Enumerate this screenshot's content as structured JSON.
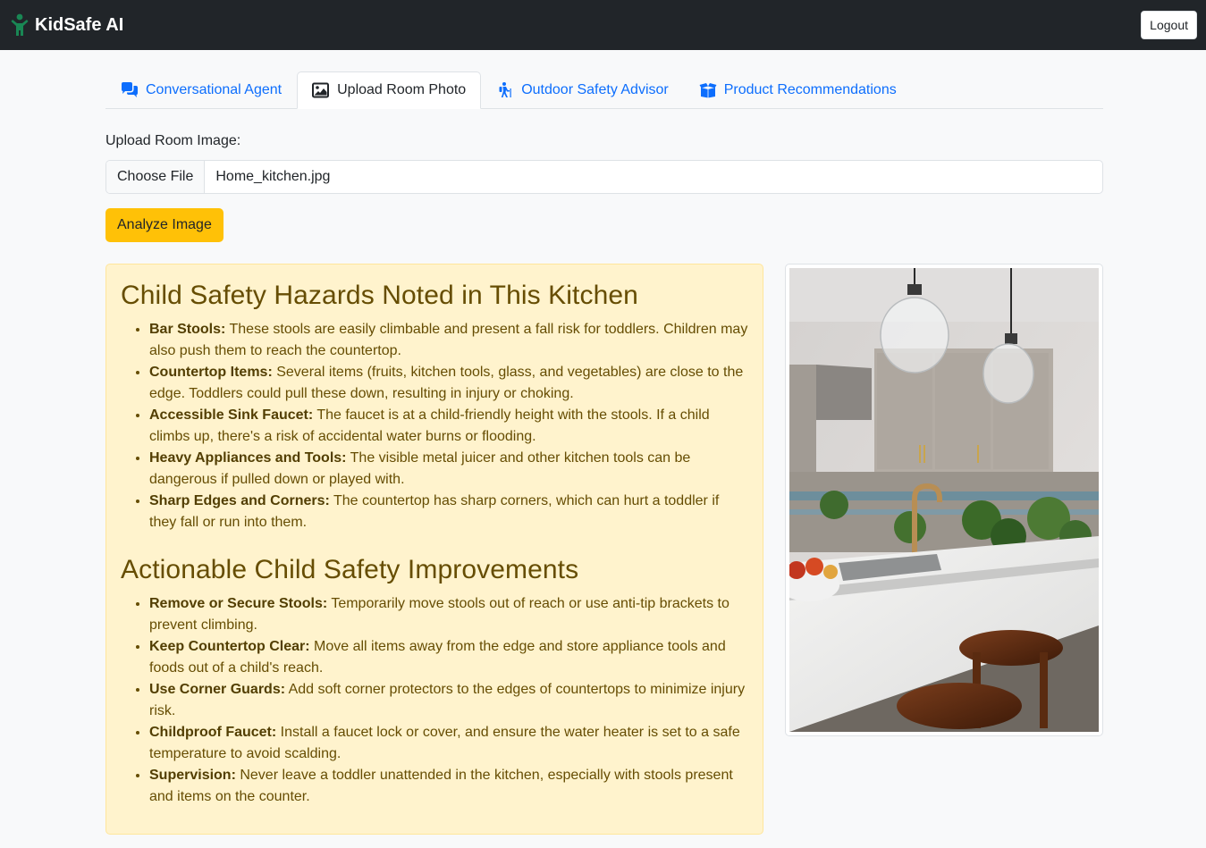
{
  "app": {
    "title": "KidSafe AI",
    "logout_label": "Logout"
  },
  "tabs": [
    {
      "label": "Conversational Agent",
      "icon": "comments-icon"
    },
    {
      "label": "Upload Room Photo",
      "icon": "image-icon",
      "active": true
    },
    {
      "label": "Outdoor Safety Advisor",
      "icon": "hiking-icon"
    },
    {
      "label": "Product Recommendations",
      "icon": "boxes-icon"
    }
  ],
  "upload": {
    "label": "Upload Room Image:",
    "choose_label": "Choose File",
    "file_name": "Home_kitchen.jpg",
    "analyze_label": "Analyze Image"
  },
  "results": {
    "hazards_title": "Child Safety Hazards Noted in This Kitchen",
    "hazards": [
      {
        "title": "Bar Stools:",
        "text": " These stools are easily climbable and present a fall risk for toddlers. Children may also push them to reach the countertop."
      },
      {
        "title": "Countertop Items:",
        "text": " Several items (fruits, kitchen tools, glass, and vegetables) are close to the edge. Toddlers could pull these down, resulting in injury or choking."
      },
      {
        "title": "Accessible Sink Faucet:",
        "text": " The faucet is at a child-friendly height with the stools. If a child climbs up, there's a risk of accidental water burns or flooding."
      },
      {
        "title": "Heavy Appliances and Tools:",
        "text": " The visible metal juicer and other kitchen tools can be dangerous if pulled down or played with."
      },
      {
        "title": "Sharp Edges and Corners:",
        "text": " The countertop has sharp corners, which can hurt a toddler if they fall or run into them."
      }
    ],
    "improvements_title": "Actionable Child Safety Improvements",
    "improvements": [
      {
        "title": "Remove or Secure Stools:",
        "text": " Temporarily move stools out of reach or use anti-tip brackets to prevent climbing."
      },
      {
        "title": "Keep Countertop Clear:",
        "text": " Move all items away from the edge and store appliance tools and foods out of a child's reach."
      },
      {
        "title": "Use Corner Guards:",
        "text": " Add soft corner protectors to the edges of countertops to minimize injury risk."
      },
      {
        "title": "Childproof Faucet:",
        "text": " Install a faucet lock or cover, and ensure the water heater is set to a safe temperature to avoid scalding."
      },
      {
        "title": "Supervision:",
        "text": " Never leave a toddler unattended in the kitchen, especially with stools present and items on the counter."
      }
    ]
  },
  "colors": {
    "navbar": "#212529",
    "brand_icon": "#198754",
    "link": "#0d6efd",
    "warning": "#ffc107",
    "alert_bg": "#fff3cd",
    "alert_text": "#664d03"
  }
}
